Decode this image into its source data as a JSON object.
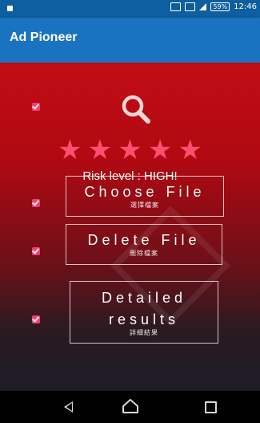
{
  "status_bar": {
    "battery": "59%",
    "time": "12:46",
    "icons": [
      "notification-square-icon",
      "vibrate-icon",
      "nfc-icon",
      "signal-icon",
      "battery-icon"
    ]
  },
  "app_bar": {
    "title": "Ad Pioneer"
  },
  "main": {
    "search_icon": "search-icon",
    "rating": {
      "stars": 5,
      "max": 5
    },
    "risk_text": "Risk level : HIGH!",
    "buttons": [
      {
        "label": "Choose File",
        "sub_label": "選擇檔案"
      },
      {
        "label": "Delete File",
        "sub_label": "刪除檔案"
      },
      {
        "label_line1": "Detailed",
        "label_line2": "results",
        "sub_label": "詳細結果"
      }
    ]
  },
  "nav_bar": {
    "items": [
      "back-icon",
      "home-icon",
      "recents-icon"
    ]
  },
  "colors": {
    "primary": "#1a73c1",
    "status": "#0d5f9f",
    "danger": "#c20d14",
    "star": "#ff4d6d",
    "checkbox": "#ff3b6a"
  }
}
